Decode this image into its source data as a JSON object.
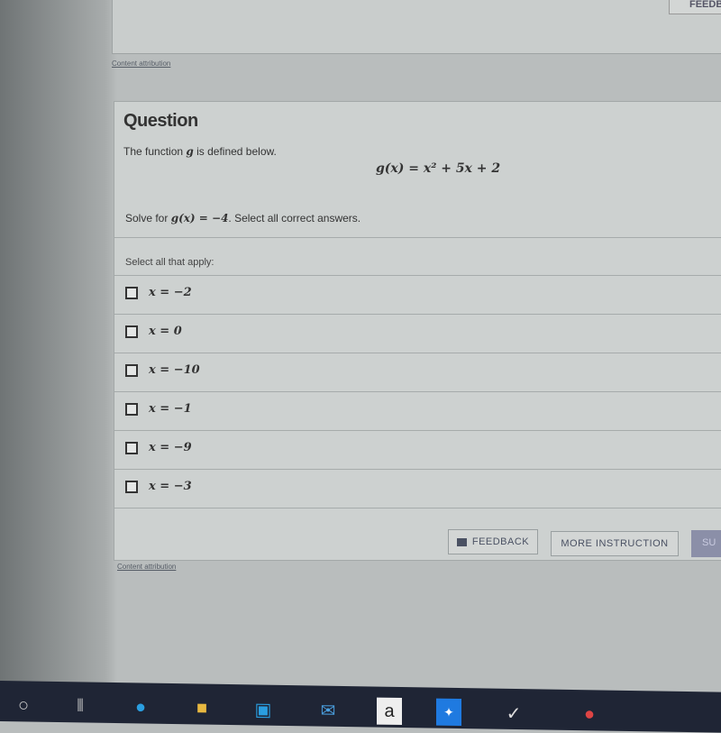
{
  "top": {
    "feedback_label": "FEEDBACK",
    "attribution": "Content attribution"
  },
  "question": {
    "title": "Question",
    "intro_prefix": "The function ",
    "intro_var": "g",
    "intro_suffix": " is defined below.",
    "equation": "g(x) = x² + 5x + 2",
    "solve_prefix": "Solve for ",
    "solve_math": "g(x) = −4",
    "solve_suffix": ". Select all correct answers.",
    "select_label": "Select all that apply:",
    "options": [
      {
        "label": "x = −2",
        "checked": false
      },
      {
        "label": "x = 0",
        "checked": false
      },
      {
        "label": "x = −10",
        "checked": false
      },
      {
        "label": "x = −1",
        "checked": false
      },
      {
        "label": "x = −9",
        "checked": false
      },
      {
        "label": "x = −3",
        "checked": false
      }
    ],
    "buttons": {
      "feedback": "FEEDBACK",
      "more_instruction": "MORE INSTRUCTION",
      "submit": "SU"
    },
    "attribution": "Content attribution"
  },
  "taskbar": {
    "icons": [
      "search-icon",
      "task-view-icon",
      "edge-icon",
      "file-explorer-icon",
      "store-icon",
      "mail-icon",
      "amazon-icon",
      "dropbox-icon",
      "app-icon",
      "chrome-icon"
    ],
    "amazon_label": "a"
  }
}
